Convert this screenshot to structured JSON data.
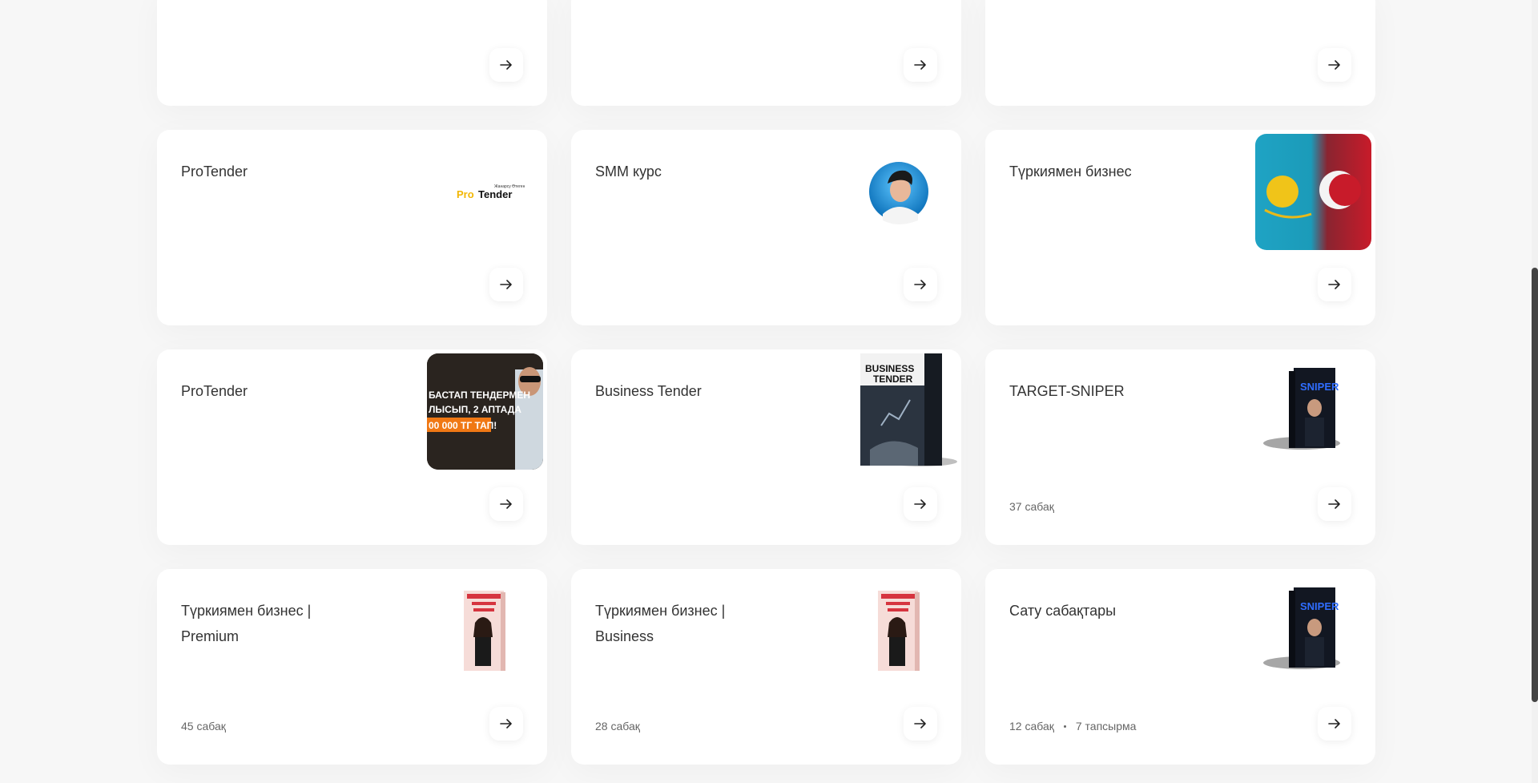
{
  "cards": [
    {
      "title": "",
      "meta": [],
      "image": "none"
    },
    {
      "title": "",
      "meta": [],
      "image": "none"
    },
    {
      "title": "",
      "meta": [],
      "image": "none"
    },
    {
      "title": "ProTender",
      "meta": [],
      "image": "protender-logo",
      "image_text": {
        "small": "Жанарсу Өтеген",
        "pro": "Pro",
        "tender": "Tender"
      }
    },
    {
      "title": "SMM курс",
      "meta": [],
      "image": "person-avatar"
    },
    {
      "title": "Түркиямен бизнес",
      "meta": [],
      "image": "kz-tr-flags"
    },
    {
      "title": "ProTender",
      "meta": [],
      "image": "protender-promo",
      "image_text": {
        "line1": "БАСТАП ТЕНДЕРМЕН",
        "line2": "ЛЫСЫП, 2 АПТАДА",
        "line3": "00 000 ТГ ТАП!"
      }
    },
    {
      "title": "Business Tender",
      "meta": [],
      "image": "business-tender-box",
      "image_text": {
        "line1": "BUSINESS",
        "line2": "TENDER"
      }
    },
    {
      "title": "TARGET-SNIPER",
      "meta": [
        "37 сабақ"
      ],
      "image": "sniper-box",
      "image_text": {
        "word": "SNIPER"
      }
    },
    {
      "title": "Түркиямен бизнес | Premium",
      "meta": [
        "45 сабақ"
      ],
      "image": "turkey-book"
    },
    {
      "title": "Түркиямен бизнес | Business",
      "meta": [
        "28 сабақ"
      ],
      "image": "turkey-book"
    },
    {
      "title": "Сату сабақтары",
      "meta": [
        "12 сабақ",
        "7 тапсырма"
      ],
      "image": "sniper-box",
      "image_text": {
        "word": "SNIPER"
      }
    }
  ],
  "arrow_icon": "arrow-right-icon",
  "colors": {
    "page_bg": "#f7f7f7",
    "card_bg": "#ffffff",
    "title": "#333333",
    "meta": "#666666",
    "accent_yellow": "#f2b705"
  }
}
